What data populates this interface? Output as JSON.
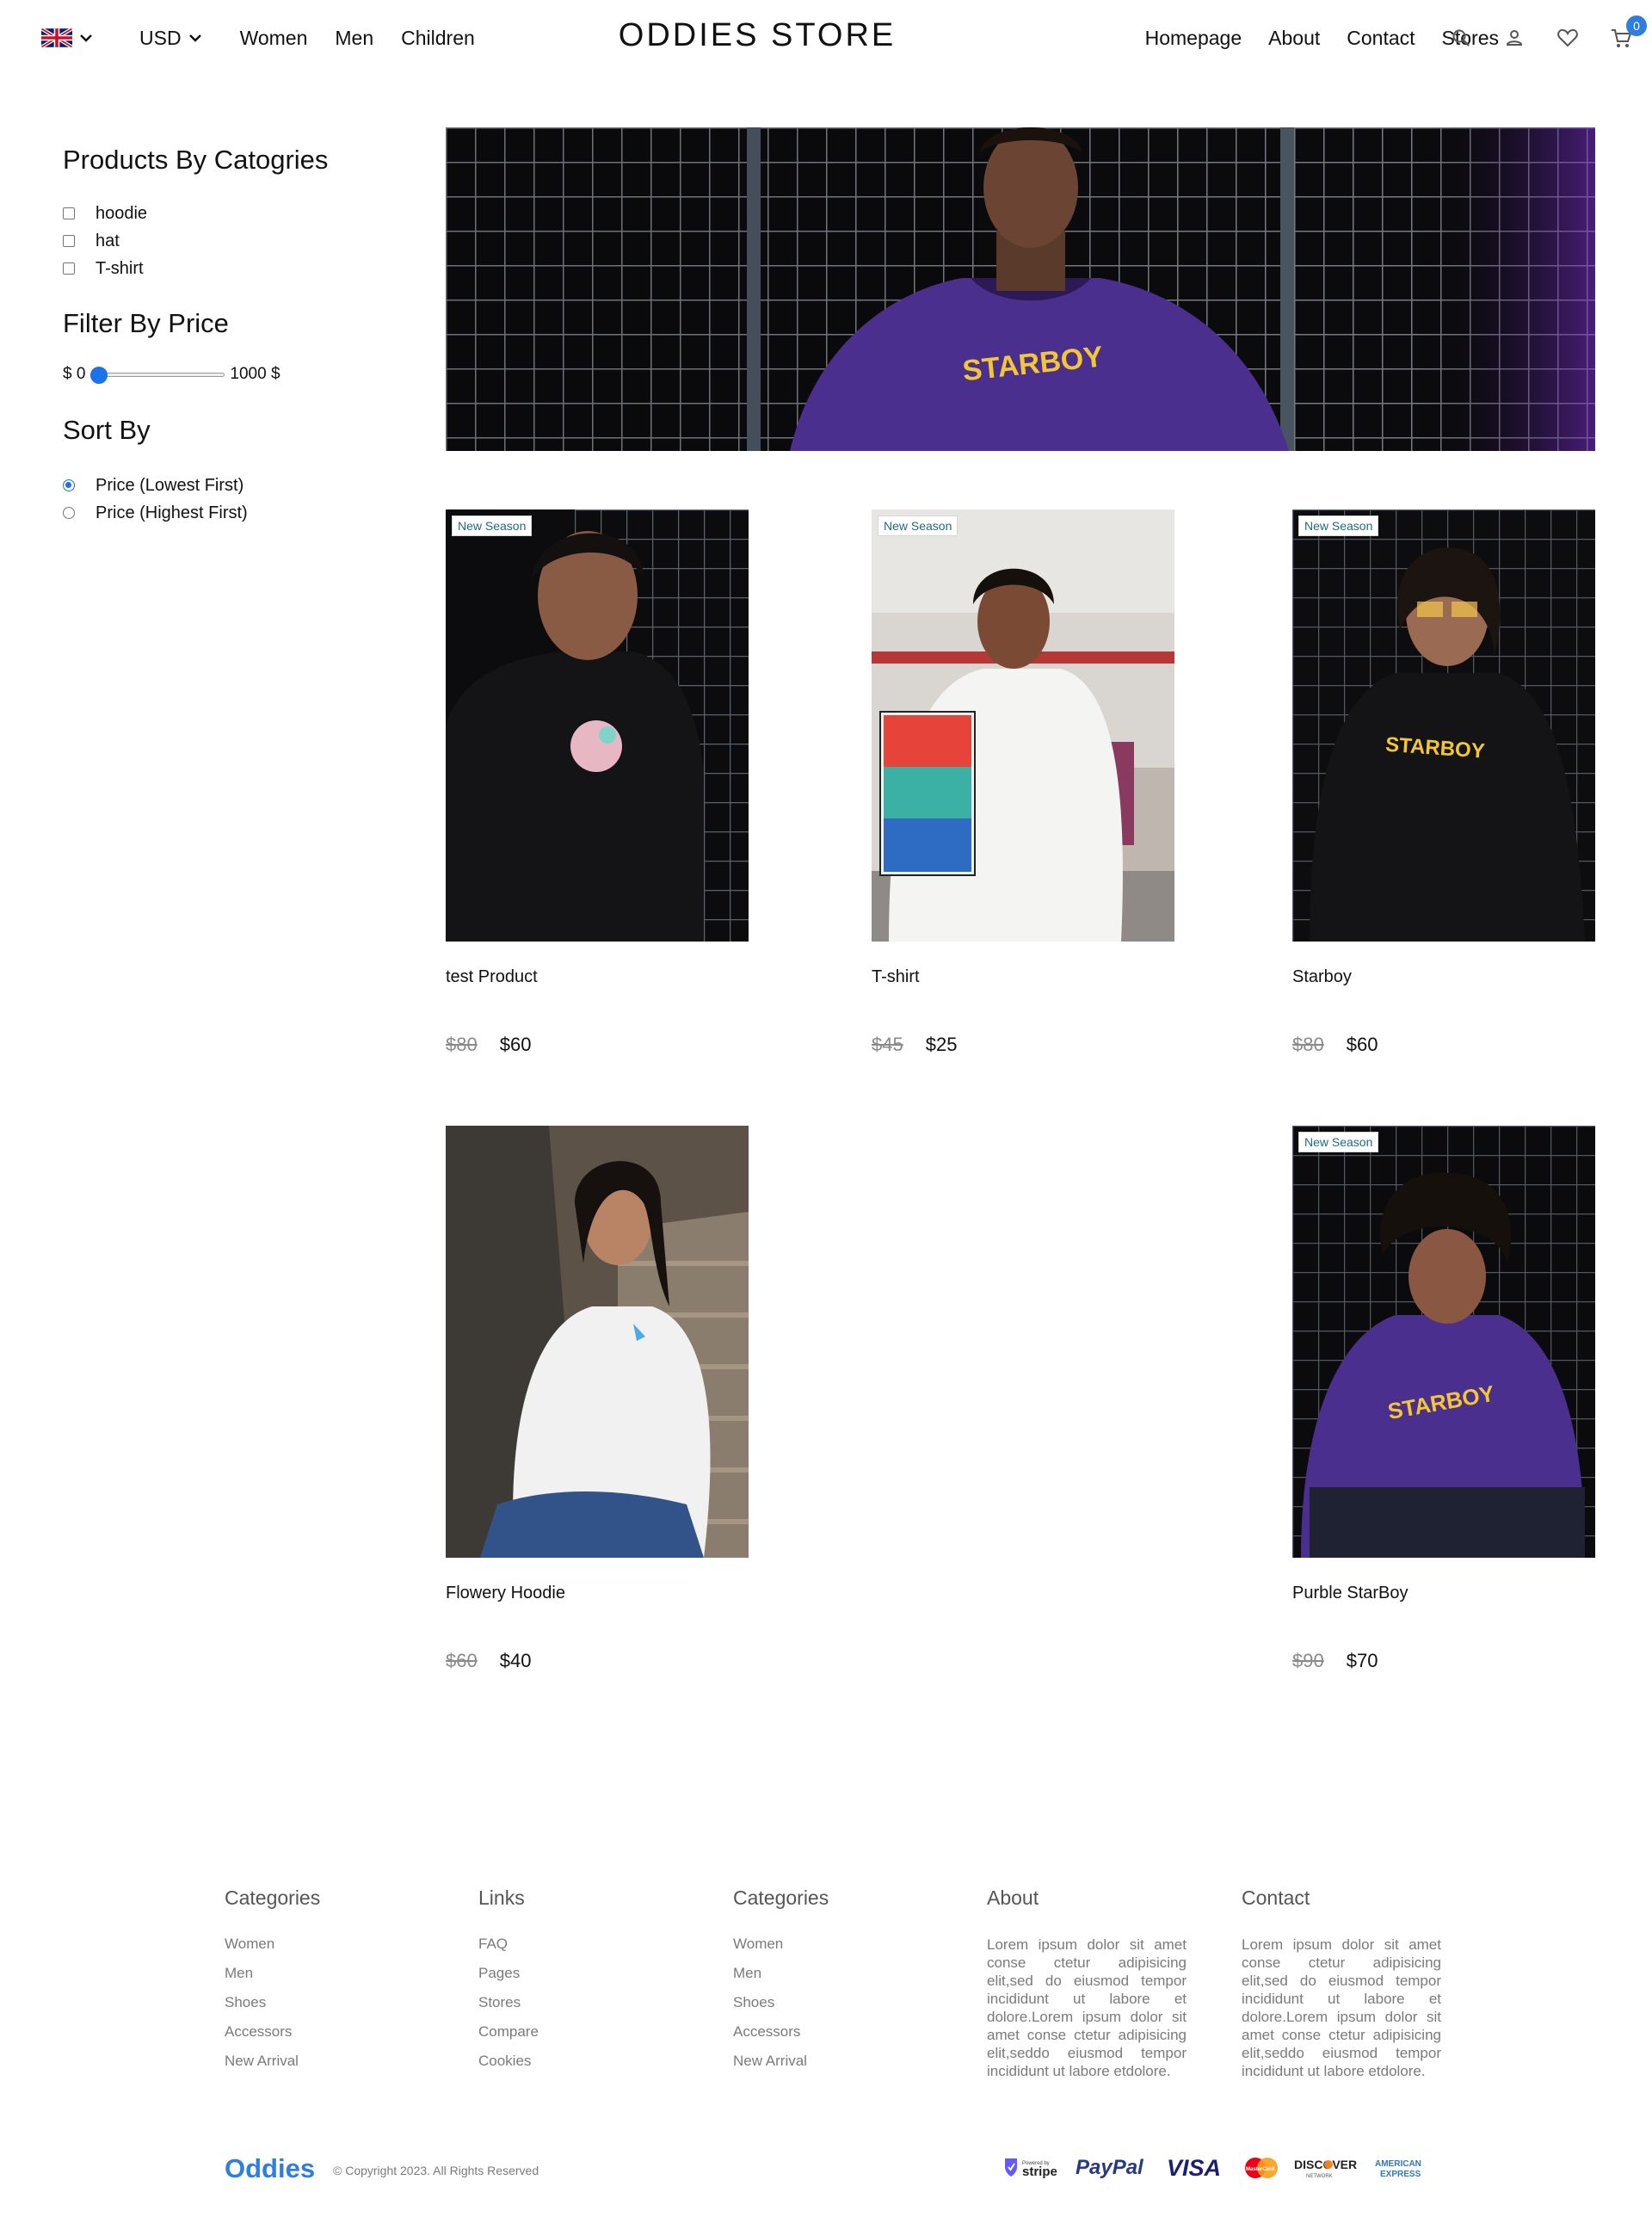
{
  "header": {
    "brand": "ODDIES STORE",
    "currency": "USD",
    "left_links": [
      "Women",
      "Men",
      "Children"
    ],
    "right_links": [
      "Homepage",
      "About",
      "Contact",
      "Stores"
    ],
    "cart_count": "0",
    "icons": [
      "uk-flag-icon",
      "chevron-down-icon",
      "search-icon",
      "user-icon",
      "heart-icon",
      "cart-icon"
    ]
  },
  "sidebar": {
    "categories_title": "Products By Catogries",
    "categories": [
      "hoodie",
      "hat",
      "T-shirt"
    ],
    "price_title": "Filter By Price",
    "price_min_label": "$ 0",
    "price_max_label": "1000 $",
    "price_value_fraction": 0.0,
    "sort_title": "Sort By",
    "sort_options": [
      "Price (Lowest First)",
      "Price (Highest First)"
    ],
    "sort_selected": 0
  },
  "products": [
    {
      "name": "test Product",
      "old_price": "$80",
      "price": "$60",
      "badge": "New Season"
    },
    {
      "name": "T-shirt",
      "old_price": "$45",
      "price": "$25",
      "badge": "New Season"
    },
    {
      "name": "Starboy",
      "old_price": "$80",
      "price": "$60",
      "badge": "New Season"
    },
    {
      "name": "Flowery Hoodie",
      "old_price": "$60",
      "price": "$40",
      "badge": ""
    },
    {
      "name": "Purble StarBoy",
      "old_price": "$90",
      "price": "$70",
      "badge": "New Season"
    }
  ],
  "footer": {
    "col1": {
      "title": "Categories",
      "items": [
        "Women",
        "Men",
        "Shoes",
        "Accessors",
        "New Arrival"
      ]
    },
    "col2": {
      "title": "Links",
      "items": [
        "FAQ",
        "Pages",
        "Stores",
        "Compare",
        "Cookies"
      ]
    },
    "col3": {
      "title": "Categories",
      "items": [
        "Women",
        "Men",
        "Shoes",
        "Accessors",
        "New Arrival"
      ]
    },
    "col4": {
      "title": "About",
      "text": "Lorem ipsum dolor sit amet conse ctetur adipisicing elit,sed do eiusmod tempor incididunt ut labore et dolore.Lorem ipsum dolor sit amet conse ctetur adipisicing elit,seddo eiusmod tempor incididunt ut labore etdolore."
    },
    "col5": {
      "title": "Contact",
      "text": "Lorem ipsum dolor sit amet conse ctetur adipisicing elit,sed do eiusmod tempor incididunt ut labore et dolore.Lorem ipsum dolor sit amet conse ctetur adipisicing elit,seddo eiusmod tempor incididunt ut labore etdolore."
    },
    "logo": "Oddies",
    "copyright": "© Copyright 2023. All Rights Reserved",
    "payments": {
      "stripe_small": "Powered by",
      "stripe": "stripe",
      "paypal": "PayPal",
      "visa": "VISA",
      "mastercard": "MasterCard",
      "discover": "DISCOVER",
      "discover_sub": "NETWORK",
      "amex_1": "AMERICAN",
      "amex_2": "EXPRESS"
    }
  },
  "colors": {
    "accent": "#2f7de1",
    "badge_text": "#1e6b7a",
    "slider": "#1a73e8",
    "muted": "#7a7a7a"
  }
}
